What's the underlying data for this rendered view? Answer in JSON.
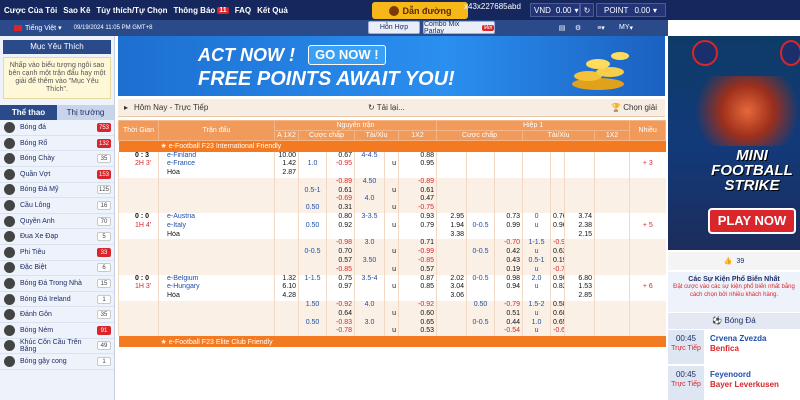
{
  "topnav": {
    "items": [
      "Cược Của Tôi",
      "Sao Kê",
      "Tùy thích/Tự Chọn",
      "Thông Báo",
      "FAQ",
      "Kết Quả"
    ],
    "notice_count": "11"
  },
  "guide_label": "Dẫn đường",
  "account": {
    "id": "x43x227685abd",
    "currency": "VND",
    "balance": "0.00",
    "point_label": "POINT",
    "point_value": "0.00"
  },
  "language": "Tiếng Việt",
  "datetime": "09/19/2024 11:05 PM GMT+8",
  "tabs": {
    "hon_hop": "Hỗn Hợp",
    "combo": "Combo Mix Parlay",
    "new": "Mới",
    "my": "MY"
  },
  "favorites": {
    "title": "Mục Yêu Thích",
    "note": "Nhấp vào biểu tượng ngôi sao bên cạnh một trận đấu hay một giải để thêm vào \"Mục Yêu Thích\"."
  },
  "sport_tabs": [
    "Thể thao",
    "Thị trường"
  ],
  "sports": [
    {
      "name": "Bóng đá",
      "count": "753",
      "hot": true
    },
    {
      "name": "Bóng Rổ",
      "count": "132",
      "hot": true
    },
    {
      "name": "Bóng Chày",
      "count": "35",
      "hot": false
    },
    {
      "name": "Quần Vợt",
      "count": "153",
      "hot": true
    },
    {
      "name": "Bóng Đá Mỹ",
      "count": "125",
      "hot": false
    },
    {
      "name": "Cầu Lông",
      "count": "16",
      "hot": false
    },
    {
      "name": "Quyền Anh",
      "count": "70",
      "hot": false
    },
    {
      "name": "Đua Xe Đạp",
      "count": "5",
      "hot": false
    },
    {
      "name": "Phi Tiêu",
      "count": "33",
      "hot": true
    },
    {
      "name": "Đặc Biệt",
      "count": "6",
      "hot": false
    },
    {
      "name": "Bóng Đá Trong Nhà",
      "count": "15",
      "hot": false
    },
    {
      "name": "Bóng Đá Ireland",
      "count": "1",
      "hot": false
    },
    {
      "name": "Đánh Gôn",
      "count": "35",
      "hot": false
    },
    {
      "name": "Bóng Ném",
      "count": "91",
      "hot": true
    },
    {
      "name": "Khúc Côn Cầu Trên Băng",
      "count": "49",
      "hot": false
    },
    {
      "name": "Bóng gậy cong",
      "count": "1",
      "hot": false
    }
  ],
  "banner": {
    "line1": "ACT NOW !",
    "go": "GO NOW !",
    "line2": "FREE POINTS AWAIT YOU!"
  },
  "filter": {
    "label": "Hôm Nay - Trực Tiếp",
    "reload": "Tải lại...",
    "pick": "Chọn giải"
  },
  "table": {
    "h_time": "Thời Gian",
    "h_match": "Trận đấu",
    "h_full": "Nguyên trận",
    "h_half": "Hiệp 1",
    "h_more": "Nhiều",
    "sub": [
      "A 1X2",
      "Cược chấp",
      "Tài/Xỉu",
      "1X2",
      "Cược chấp",
      "Tài/Xỉu",
      "1X2"
    ],
    "league1": "e-Football F23 International Friendly",
    "league2": "e-Football F23 Elite Club Friendly"
  },
  "matches": [
    {
      "score": "0 : 3",
      "time": "2H 3'",
      "home": "e-Finland",
      "away": "e-France",
      "draw": "Hòa",
      "more": "+ 3",
      "rows": [
        [
          "10.00",
          "",
          "0.67",
          "4-4.5",
          "",
          "0.88",
          "",
          "",
          "",
          "",
          "",
          "",
          ""
        ],
        [
          "1.42",
          "1.0",
          "-0.95",
          "",
          "u",
          "0.95",
          "",
          "",
          "",
          "",
          "",
          "",
          ""
        ],
        [
          "2.87",
          "",
          "",
          "",
          "",
          "",
          "",
          "",
          "",
          "",
          "",
          "",
          ""
        ],
        [
          "",
          "",
          "-0.89",
          "4.50",
          "",
          "-0.89",
          "",
          "",
          "",
          "",
          "",
          "",
          ""
        ],
        [
          "",
          "0.5-1",
          "0.61",
          "",
          "u",
          "0.61",
          "",
          "",
          "",
          "",
          "",
          "",
          ""
        ],
        [
          "",
          "",
          "-0.69",
          "4.0",
          "",
          "0.47",
          "",
          "",
          "",
          "",
          "",
          "",
          ""
        ],
        [
          "",
          "0.50",
          "0.31",
          "",
          "u",
          "-0.75",
          "",
          "",
          "",
          "",
          "",
          "",
          ""
        ]
      ]
    },
    {
      "score": "0 : 0",
      "time": "1H 4'",
      "home": "e-Austria",
      "away": "e-Italy",
      "draw": "Hòa",
      "more": "+ 5",
      "rows": [
        [
          "",
          "",
          "0.80",
          "3-3.5",
          "",
          "0.93",
          "2.95",
          "",
          "0.73",
          "0",
          "0.76",
          "3.74",
          ""
        ],
        [
          "",
          "0.50",
          "0.92",
          "",
          "u",
          "0.79",
          "1.94",
          "0-0.5",
          "0.99",
          "u",
          "0.96",
          "2.38",
          ""
        ],
        [
          "",
          "",
          "",
          "",
          "",
          "",
          "3.38",
          "",
          "",
          "",
          "",
          "2.15",
          ""
        ],
        [
          "",
          "",
          "-0.98",
          "3.0",
          "",
          "0.71",
          "",
          "",
          "-0.70",
          "1-1.5",
          "-0.91",
          ""
        ],
        [
          "",
          "0-0.5",
          "0.70",
          "",
          "u",
          "-0.99",
          "",
          "0-0.5",
          "0.42",
          "u",
          "0.63",
          ""
        ],
        [
          "",
          "",
          "0.57",
          "3.50",
          "",
          "-0.85",
          "",
          "",
          "0.43",
          "0.5-1",
          "0.19",
          ""
        ],
        [
          "",
          "",
          "-0.85",
          "",
          "u",
          "0.57",
          "",
          "",
          "0.19",
          "u",
          "-0.77",
          ""
        ]
      ]
    },
    {
      "score": "0 : 0",
      "time": "1H 3'",
      "home": "e-Belgium",
      "away": "e-Hungary",
      "draw": "Hòa",
      "more": "+ 6",
      "rows": [
        [
          "1.32",
          "1-1.5",
          "0.75",
          "3.5-4",
          "",
          "0.87",
          "2.02",
          "0-0.5",
          "0.98",
          "2.0",
          "0.90",
          "6.80",
          ""
        ],
        [
          "6.10",
          "",
          "0.97",
          "",
          "u",
          "0.85",
          "3.04",
          "",
          "0.94",
          "u",
          "0.82",
          "1.53",
          ""
        ],
        [
          "4.28",
          "",
          "",
          "",
          "",
          "",
          "3.06",
          "",
          "",
          "",
          "",
          "2.85",
          ""
        ],
        [
          "",
          "1.50",
          "-0.92",
          "4.0",
          "",
          "-0.92",
          "",
          "0.50",
          "-0.79",
          "1.5-2",
          "0.58",
          ""
        ],
        [
          "",
          "",
          "0.64",
          "",
          "u",
          "0.60",
          "",
          "",
          "0.51",
          "u",
          "0.68",
          ""
        ],
        [
          "",
          "0.50",
          "-0.83",
          "3.0",
          "",
          "0.65",
          "",
          "0-0.5",
          "0.44",
          "1.0",
          "0.65",
          ""
        ],
        [
          "",
          "",
          "-0.78",
          "",
          "u",
          "0.53",
          "",
          "",
          "-0.54",
          "u",
          "-0.69",
          ""
        ]
      ]
    }
  ],
  "right": {
    "mini_title": "MINI FOOTBALL STRIKE",
    "play": "PLAY NOW",
    "likes": "39",
    "events_title": "Các Sự Kiện Phổ Biến Nhất",
    "events_sub": "Đặt cược vào các sự kiện phổ biến nhất bằng cách chọn bởi nhiều khách hàng.",
    "sport": "Bóng Đá",
    "events": [
      {
        "time": "00:45",
        "live": "Trực Tiếp",
        "home": "Crvena Zvezda",
        "away": "Benfica"
      },
      {
        "time": "00:45",
        "live": "Trực Tiếp",
        "home": "Feyenoord",
        "away": "Bayer Leverkusen"
      }
    ]
  },
  "colors": {
    "navy": "#16275e",
    "orange": "#f47a22",
    "red": "#d9262b",
    "blue": "#1f4ea8"
  }
}
